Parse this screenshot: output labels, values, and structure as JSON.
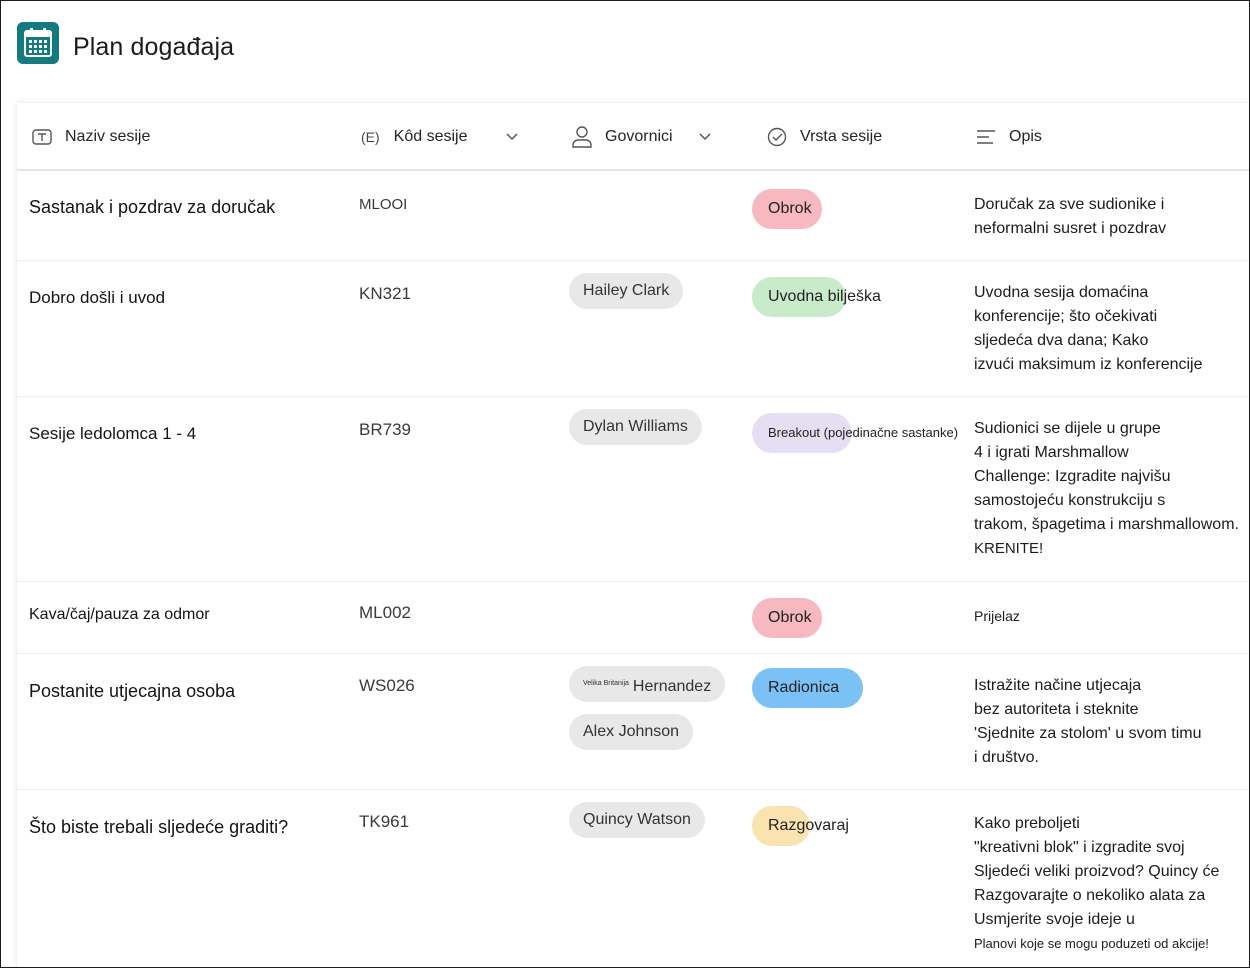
{
  "app": {
    "title": "Plan događaja",
    "icon": "calendar-icon",
    "accent": "#137a7f"
  },
  "columns": [
    {
      "label": "Naziv sesije",
      "icon": "text-field-icon"
    },
    {
      "prefix": "(E)",
      "label": "Kôd sesije",
      "icon": "chevron-down-icon"
    },
    {
      "label": "Govornici",
      "icon": "person-icon"
    },
    {
      "label": "Vrsta sesije",
      "icon": "check-circle-icon"
    },
    {
      "label": "Opis",
      "icon": "lines-icon"
    }
  ],
  "type_colors": {
    "meal": "#f7b8c0",
    "keynote": "#c8ecca",
    "breakout": "#e6dff3",
    "workshop": "#7cc1f6",
    "talk": "#fbe3b0"
  },
  "rows": [
    {
      "name": "Sastanak i pozdrav za doručak",
      "code": "MLOOI",
      "speakers": [],
      "type": "Obrok",
      "description": [
        "Doručak za sve sudionike i",
        "neformalni susret i pozdrav"
      ]
    },
    {
      "name": "Dobro došli i uvod",
      "code": "KN321",
      "speakers": [
        "Hailey Clark"
      ],
      "type": "Uvodna bilješka",
      "description": [
        "Uvodna sesija domaćina",
        "konferencije; što očekivati",
        "sljedeća dva dana; Kako",
        "izvući maksimum iz konferencije"
      ]
    },
    {
      "name": "Sesije ledolomca 1 - 4",
      "code": "BR739",
      "speakers": [
        "Dylan Williams"
      ],
      "type": "Breakout (pojedinačne sastanke)",
      "description": [
        "Sudionici se dijele u grupe",
        "4  i igrati Marshmallow",
        "Challenge: Izgradite najvišu",
        "samostojeću konstrukciju s",
        "trakom, špagetima i marshmallowom.",
        "KRENITE!"
      ]
    },
    {
      "name": "Kava/čaj/pauza za odmor",
      "code": "ML002",
      "speakers": [],
      "type": "Obrok",
      "description": [
        "Prijelaz"
      ]
    },
    {
      "name": "Postanite utjecajna osoba",
      "code": "WS026",
      "speakers": [
        "Hernandez",
        "Alex Johnson"
      ],
      "speaker_prefix": "Velika Britanija",
      "type": "Radionica",
      "description": [
        "Istražite načine utjecaja",
        "bez autoriteta i steknite",
        "'Sjednite za stolom' u svom timu",
        "i društvo."
      ]
    },
    {
      "name": "Što biste trebali sljedeće graditi?",
      "code": "TK961",
      "speakers": [
        "Quincy Watson"
      ],
      "type": "Razgovaraj",
      "description": [
        "Kako preboljeti",
        "\"kreativni blok\" i izgradite svoj",
        "Sljedeći veliki proizvod? Quincy će",
        "Razgovarajte o nekoliko alata za",
        "Usmjerite svoje ideje u",
        "Planovi koje se mogu poduzeti od akcije!"
      ]
    }
  ]
}
